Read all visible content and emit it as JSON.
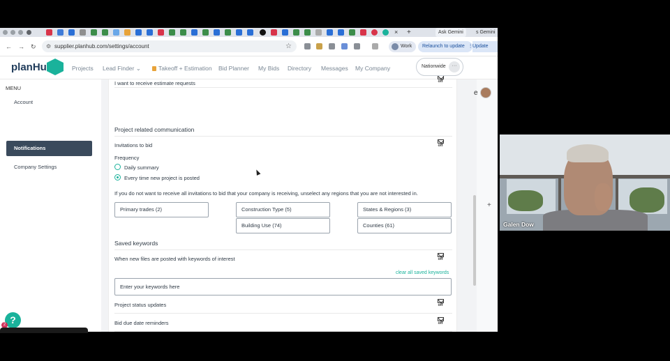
{
  "browser": {
    "ask_label": "Ask Gemini",
    "gemini_label": "s Gemini",
    "url": "supplier.planhub.com/settings/account",
    "profile_label": "Work",
    "relaunch_label": "Relaunch to update",
    "update_label": "Update",
    "new_tab": "+",
    "close_tab": "×"
  },
  "app": {
    "logo": "planHub",
    "nav": [
      {
        "label": "Projects"
      },
      {
        "label": "Lead Finder ⌄"
      },
      {
        "label": "Takeoff + Estimation"
      },
      {
        "label": "Bid Planner"
      },
      {
        "label": "My Bids"
      },
      {
        "label": "Directory"
      },
      {
        "label": "Messages"
      },
      {
        "label": "My Company"
      }
    ],
    "nationwide_label": "Nationwide",
    "nationwide_more": "···",
    "user_letter": "e"
  },
  "sidebar": {
    "title": "MENU",
    "items": [
      {
        "label": "Account"
      },
      {
        "label": "Notifications"
      },
      {
        "label": "Company Settings"
      }
    ],
    "help": "?",
    "help_badge": "2"
  },
  "main": {
    "estimate_requests": "I want to receive estimate requests",
    "off_label": "off",
    "project_comm_title": "Project related communication",
    "invitations": "Invitations to bid",
    "frequency": "Frequency",
    "freq_daily": "Daily summary",
    "freq_every": "Every time new project is posted",
    "regions_note": "If you do not want to receive all invitations to bid that your company is receiving, unselect any regions that you are not interested in.",
    "filters": {
      "primary_trades": "Primary trades (2)",
      "construction_type": "Construction Type (5)",
      "states_regions": "States & Regions (3)",
      "building_use": "Building Use (74)",
      "counties": "Counties (61)"
    },
    "saved_keywords_title": "Saved keywords",
    "keywords_row": "When new files are posted with keywords of interest",
    "clear_keywords": "clear all saved keywords",
    "keywords_placeholder": "Enter your keywords here",
    "status_updates": "Project status updates",
    "due_reminders": "Bid due date reminders"
  },
  "video": {
    "participant": "Galen Dow"
  },
  "colors": {
    "brand": "#1ab29b",
    "sidebar_active": "#3a4a5c",
    "logo_text": "#1f3b5a"
  }
}
